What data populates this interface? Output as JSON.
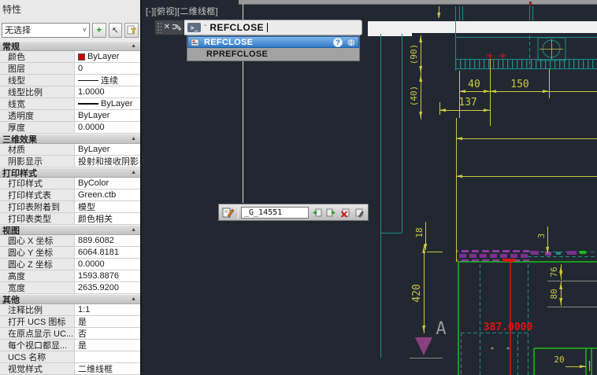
{
  "palette": {
    "title": "特性",
    "selection": "无选择",
    "sections": [
      {
        "title": "常规",
        "rows": [
          {
            "label": "颜色",
            "value": "ByLayer"
          },
          {
            "label": "图层",
            "value": "0"
          },
          {
            "label": "线型",
            "value": "连续"
          },
          {
            "label": "线型比例",
            "value": "1.0000"
          },
          {
            "label": "线宽",
            "value": "ByLayer"
          },
          {
            "label": "透明度",
            "value": "ByLayer"
          },
          {
            "label": "厚度",
            "value": "0.0000"
          }
        ]
      },
      {
        "title": "三维效果",
        "rows": [
          {
            "label": "材质",
            "value": "ByLayer"
          },
          {
            "label": "阴影显示",
            "value": "投射和接收阴影"
          }
        ]
      },
      {
        "title": "打印样式",
        "rows": [
          {
            "label": "打印样式",
            "value": "ByColor"
          },
          {
            "label": "打印样式表",
            "value": "Green.ctb"
          },
          {
            "label": "打印表附着到",
            "value": "模型"
          },
          {
            "label": "打印表类型",
            "value": "颜色相关"
          }
        ]
      },
      {
        "title": "视图",
        "rows": [
          {
            "label": "圆心 X 坐标",
            "value": "889.6082"
          },
          {
            "label": "圆心 Y 坐标",
            "value": "6064.8181"
          },
          {
            "label": "圆心 Z 坐标",
            "value": "0.0000"
          },
          {
            "label": "高度",
            "value": "1593.8876"
          },
          {
            "label": "宽度",
            "value": "2635.9200"
          }
        ]
      },
      {
        "title": "其他",
        "rows": [
          {
            "label": "注释比例",
            "value": "1:1"
          },
          {
            "label": "打开 UCS 图标",
            "value": "是"
          },
          {
            "label": "在原点显示 UC...",
            "value": "否"
          },
          {
            "label": "每个视口都显...",
            "value": "是"
          },
          {
            "label": "UCS 名称",
            "value": ""
          },
          {
            "label": "视觉样式",
            "value": "二维线框"
          }
        ]
      }
    ]
  },
  "viewport": {
    "controls": "[-][俯视][二维线框]"
  },
  "command": {
    "typed": "REFCLOSE",
    "prompt": ">_",
    "recent_mark": "-",
    "suggestions": [
      "REFCLOSE",
      "RPREFCLOSE"
    ],
    "help_glyph": "?"
  },
  "refedit": {
    "name": "_G_14551"
  },
  "drawing": {
    "labels": {
      "w40": "40",
      "w150": "150",
      "w137": "137",
      "p90": "(90)",
      "p40": "(40)",
      "h18": "18",
      "h3": "3",
      "h420": "420",
      "h76": "76",
      "h80": "80",
      "w20": "20",
      "red_dim": "387.0000",
      "datum": "A"
    }
  },
  "icons": {
    "collapse": "▲",
    "close": "✕",
    "combo_arrow": "˅",
    "plus": "+",
    "cursor": "↖"
  },
  "colors": {
    "canvas_bg": "#222831",
    "cad_yellow": "#c9c943",
    "cad_teal": "#1f8c8c",
    "cad_green": "#17bd17",
    "cad_red": "#e31212",
    "cad_magenta": "#7c2f8f",
    "highlight_blue": "#3079c8",
    "swatch_red": "#cc0000"
  }
}
